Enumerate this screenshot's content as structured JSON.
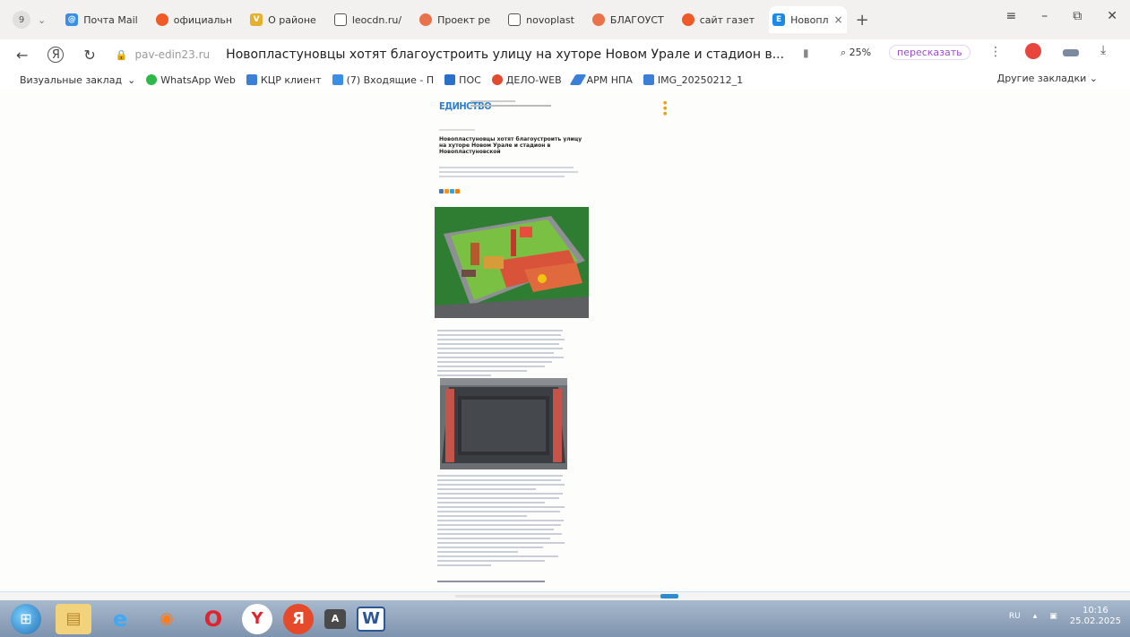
{
  "tabs": {
    "count": "9",
    "items": [
      {
        "label": "Почта Mail",
        "color": "#3a8ee6",
        "glyph": "@"
      },
      {
        "label": "официальн",
        "color": "#f05a28",
        "glyph": ""
      },
      {
        "label": "О районе",
        "color": "#e5b02d",
        "glyph": "V"
      },
      {
        "label": "leocdn.ru/",
        "color": "#ffffff",
        "glyph": ""
      },
      {
        "label": "Проект ре",
        "color": "#e8734a",
        "glyph": ""
      },
      {
        "label": "novoplast",
        "color": "#ffffff",
        "glyph": ""
      },
      {
        "label": "БЛАГОУСТ",
        "color": "#e8734a",
        "glyph": ""
      },
      {
        "label": "сайт газет",
        "color": "#f05a28",
        "glyph": ""
      }
    ],
    "active": {
      "label": "Новопл",
      "color": "#1e88e5",
      "glyph": "E"
    }
  },
  "nav": {
    "url": "pav-edin23.ru",
    "title": "Новопластуновцы хотят благоустроить улицу на хуторе Новом Урале и стадион в...",
    "zoom": "25%",
    "retell": "пересказать"
  },
  "bookmarks": {
    "items": [
      {
        "label": "Визуальные заклад",
        "color": ""
      },
      {
        "label": "WhatsApp Web",
        "color": "#2fb84a"
      },
      {
        "label": "КЦР клиент",
        "color": "#3c7fd6"
      },
      {
        "label": "(7) Входящие - П",
        "color": "#3a8ee6"
      },
      {
        "label": "ПОС",
        "color": "#2a6fc9"
      },
      {
        "label": "ДЕЛО-WEB",
        "color": "#e14b2e"
      },
      {
        "label": "АРМ НПА",
        "color": "#3c7fd6"
      },
      {
        "label": "IMG_20250212_1",
        "color": "#3c7fd6"
      }
    ],
    "other": "Другие закладки"
  },
  "article": {
    "logo": "ЕДИНСТВО",
    "headline": "Новопластуновцы хотят благоустроить улицу на хуторе Новом Урале и стадион в Новопластуновской"
  },
  "taskbar": {
    "lang": "RU",
    "time": "10:16",
    "date": "25.02.2025"
  }
}
